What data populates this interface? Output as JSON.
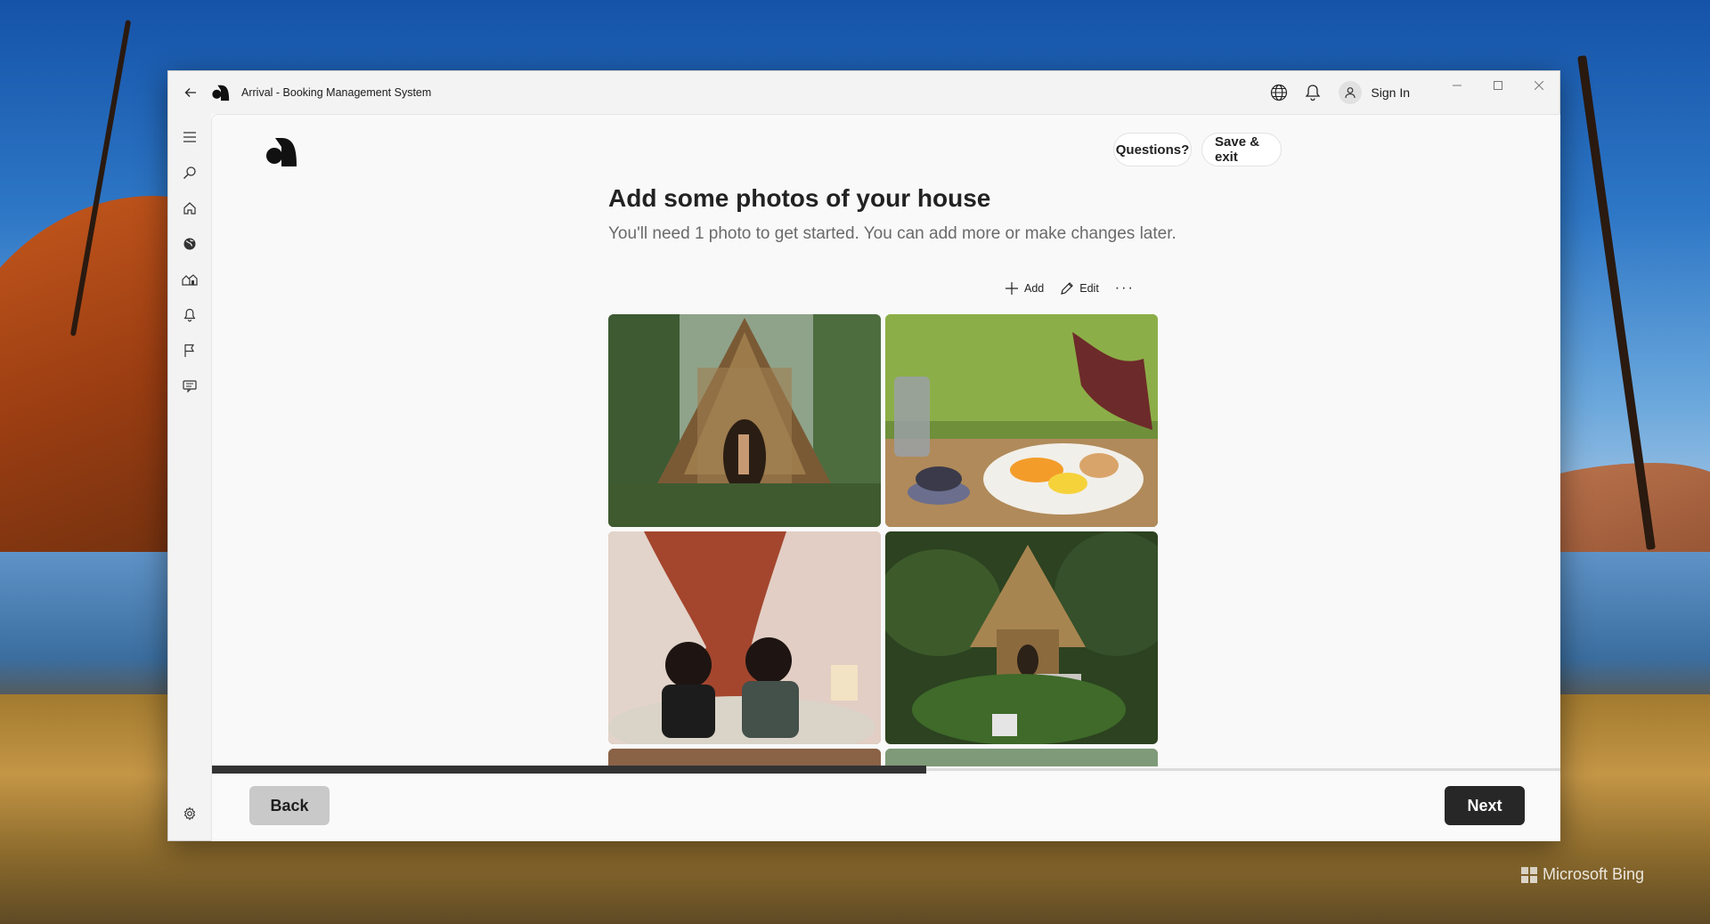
{
  "window": {
    "title": "Arrival - Booking Management System",
    "sign_in_label": "Sign In"
  },
  "nav_rail": {
    "items": [
      "menu-icon",
      "search-icon",
      "home-icon",
      "globe-icon",
      "houses-icon",
      "bell-icon",
      "flag-icon",
      "chat-icon"
    ],
    "bottom": "settings-icon"
  },
  "header": {
    "questions_label": "Questions?",
    "save_exit_label": "Save & exit"
  },
  "main": {
    "title": "Add some photos of your house",
    "subtitle": "You'll need 1 photo to get started. You can add more or make changes later.",
    "toolbar": {
      "add_label": "Add",
      "edit_label": "Edit",
      "more_label": "···"
    },
    "photos": [
      "thatched-bamboo-house",
      "breakfast-table",
      "two-women-on-bed",
      "hut-in-garden",
      "interior-partial",
      "landscape-partial"
    ]
  },
  "progress": {
    "fraction": 0.53
  },
  "footer": {
    "back_label": "Back",
    "next_label": "Next"
  },
  "desktop": {
    "watermark": "Microsoft Bing"
  },
  "colors": {
    "primary_dark": "#272727",
    "secondary_button": "#c9c9c9",
    "window_bg": "#f9f9f9"
  }
}
